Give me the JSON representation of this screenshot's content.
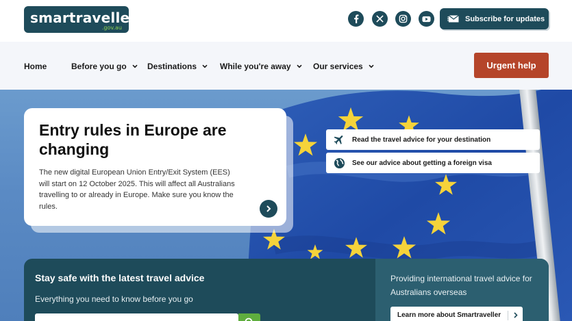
{
  "header": {
    "logo_main": "smartraveller",
    "logo_sub": ".gov.au",
    "social": [
      {
        "icon": "facebook-icon",
        "label": "f"
      },
      {
        "icon": "x-icon",
        "label": "X"
      },
      {
        "icon": "instagram-icon",
        "label": ""
      },
      {
        "icon": "youtube-icon",
        "label": ""
      }
    ],
    "subscribe_label": "Subscribe for updates"
  },
  "nav": {
    "items": [
      {
        "label": "Home",
        "has_dropdown": false
      },
      {
        "label": "Before you go",
        "has_dropdown": true
      },
      {
        "label": "Destinations",
        "has_dropdown": true
      },
      {
        "label": "While you're away",
        "has_dropdown": true
      },
      {
        "label": "Our services",
        "has_dropdown": true
      }
    ],
    "urgent_label": "Urgent help"
  },
  "hero": {
    "title": "Entry rules in Europe are changing",
    "description": "The new digital European Union Entry/Exit System (EES) will start on 12 October 2025. This will affect all Australians travelling to or already in Europe. Make sure you know the rules.",
    "quick_links": [
      {
        "icon": "plane-icon",
        "label": "Read the travel advice for your destination"
      },
      {
        "icon": "globe-icon",
        "label": "See our advice about getting a foreign visa"
      }
    ]
  },
  "panel": {
    "title": "Stay safe with the latest travel advice",
    "subtitle": "Everything you need to know before you go",
    "right_text": "Providing international travel advice for Australians overseas",
    "learn_more_label": "Learn more about Smartraveller"
  },
  "colors": {
    "brand_dark": "#1e4b5a",
    "urgent": "#b5452a",
    "search_green": "#5fae3e",
    "logo_accent": "#8fd14f"
  }
}
